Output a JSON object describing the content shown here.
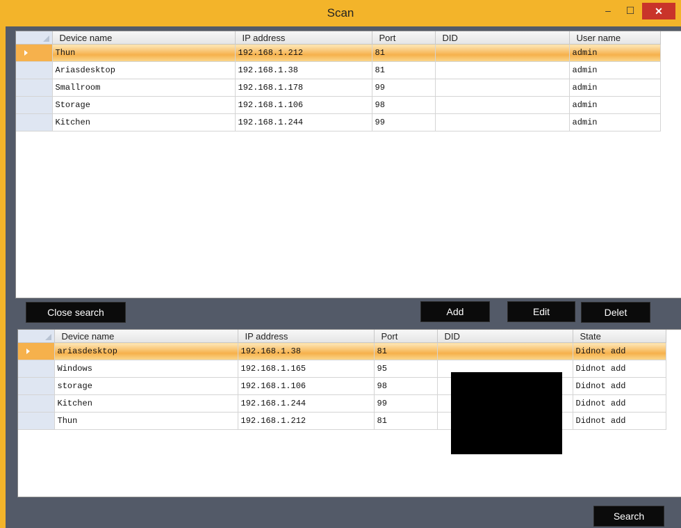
{
  "window": {
    "title": "Scan",
    "minimize_glyph": "–",
    "maximize_glyph": "☐",
    "close_glyph": "✕"
  },
  "top_table": {
    "columns": [
      "Device name",
      "IP address",
      "Port",
      "DID",
      "User name"
    ],
    "rows": [
      {
        "name": "Thun",
        "ip": "192.168.1.212",
        "port": "81",
        "did": "",
        "user": "admin"
      },
      {
        "name": "Ariasdesktop",
        "ip": "192.168.1.38",
        "port": "81",
        "did": "",
        "user": "admin"
      },
      {
        "name": "Smallroom",
        "ip": "192.168.1.178",
        "port": "99",
        "did": "",
        "user": "admin"
      },
      {
        "name": "Storage",
        "ip": "192.168.1.106",
        "port": "98",
        "did": "",
        "user": "admin"
      },
      {
        "name": "Kitchen",
        "ip": "192.168.1.244",
        "port": "99",
        "did": "",
        "user": "admin"
      }
    ]
  },
  "buttons": {
    "close_search": "Close search",
    "add": "Add",
    "edit": "Edit",
    "delete": "Delet",
    "search": "Search"
  },
  "bottom_table": {
    "columns": [
      "Device name",
      "IP address",
      "Port",
      "DID",
      "State"
    ],
    "rows": [
      {
        "name": "ariasdesktop",
        "ip": "192.168.1.38",
        "port": "81",
        "did": "",
        "state": "Didnot add"
      },
      {
        "name": "Windows",
        "ip": "192.168.1.165",
        "port": "95",
        "did": "",
        "state": "Didnot add"
      },
      {
        "name": "storage",
        "ip": "192.168.1.106",
        "port": "98",
        "did": "",
        "state": "Didnot add"
      },
      {
        "name": "Kitchen",
        "ip": "192.168.1.244",
        "port": "99",
        "did": "",
        "state": "Didnot add"
      },
      {
        "name": "Thun",
        "ip": "192.168.1.212",
        "port": "81",
        "did": "",
        "state": "Didnot add"
      }
    ]
  },
  "colors": {
    "title_bar": "#f3b42a",
    "frame": "#535a68",
    "selected_row": "#f6b14c",
    "close_button": "#c9342a"
  }
}
